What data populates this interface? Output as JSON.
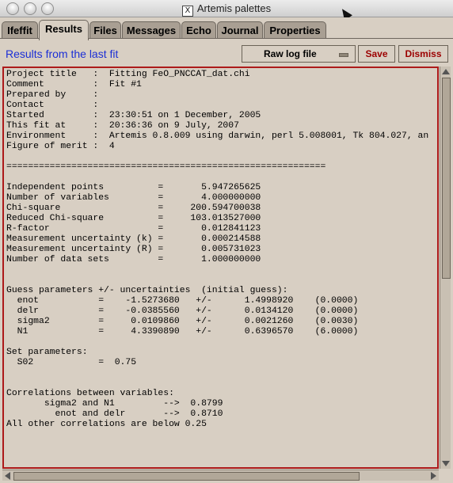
{
  "window_title": "Artemis palettes",
  "tabs": [
    {
      "label": "Ifeffit"
    },
    {
      "label": "Results"
    },
    {
      "label": "Files"
    },
    {
      "label": "Messages"
    },
    {
      "label": "Echo"
    },
    {
      "label": "Journal"
    },
    {
      "label": "Properties"
    }
  ],
  "active_tab": "Results",
  "header": {
    "text": "Results from the last fit",
    "dropdown_value": "Raw log file",
    "save_label": "Save",
    "dismiss_label": "Dismiss"
  },
  "log_text": "Project title   :  Fitting FeO_PNCCAT_dat.chi\nComment         :  Fit #1\nPrepared by     :\nContact         :\nStarted         :  23:30:51 on 1 December, 2005\nThis fit at     :  20:36:36 on 9 July, 2007\nEnvironment     :  Artemis 0.8.009 using darwin, perl 5.008001, Tk 804.027, an\nFigure of merit :  4\n\n===========================================================\n\nIndependent points          =       5.947265625\nNumber of variables         =       4.000000000\nChi-square                  =     200.594700038\nReduced Chi-square          =     103.013527000\nR-factor                    =       0.012841123\nMeasurement uncertainty (k) =       0.000214588\nMeasurement uncertainty (R) =       0.005731023\nNumber of data sets         =       1.000000000\n\n\nGuess parameters +/- uncertainties  (initial guess):\n  enot           =    -1.5273680   +/-      1.4998920    (0.0000)\n  delr           =    -0.0385560   +/-      0.0134120    (0.0000)\n  sigma2         =     0.0109860   +/-      0.0021260    (0.0030)\n  N1             =     4.3390890   +/-      0.6396570    (6.0000)\n\nSet parameters:\n  S02            =  0.75\n\n\nCorrelations between variables:\n       sigma2 and N1         -->  0.8799\n         enot and delr       -->  0.8710\nAll other correlations are below 0.25",
  "icons": {
    "close": "close-icon",
    "minimize": "minimize-icon",
    "zoom": "zoom-icon",
    "x11": "x11-icon",
    "cursor": "mouse-cursor-icon"
  },
  "colors": {
    "window_bg": "#d8cfc3",
    "header_text": "#1c2fd6",
    "button_text": "#9c0000",
    "text_border": "#ad1a1a"
  }
}
